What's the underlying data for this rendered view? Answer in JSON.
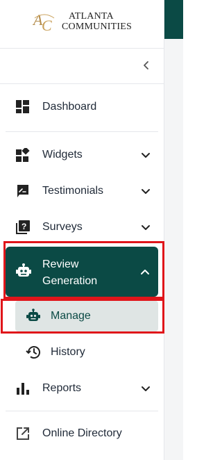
{
  "brand": {
    "line1": "ATLANTA",
    "line2": "COMMUNITIES",
    "mark": "AC"
  },
  "colors": {
    "primary": "#0b4a45",
    "highlight": "#e0151a",
    "selected_bg": "#dfe5e4"
  },
  "nav": {
    "dashboard": "Dashboard",
    "widgets": "Widgets",
    "testimonials": "Testimonials",
    "surveys": "Surveys",
    "review_generation": "Review Generation",
    "manage": "Manage",
    "history": "History",
    "reports": "Reports",
    "online_directory": "Online Directory"
  },
  "icons": {
    "dashboard": "dashboard-icon",
    "widgets": "widgets-icon",
    "testimonials": "testimonial-icon",
    "surveys": "survey-icon",
    "review_generation": "robot-icon",
    "manage": "robot-icon",
    "history": "history-icon",
    "reports": "bar-chart-icon",
    "online_directory": "external-link-icon"
  }
}
